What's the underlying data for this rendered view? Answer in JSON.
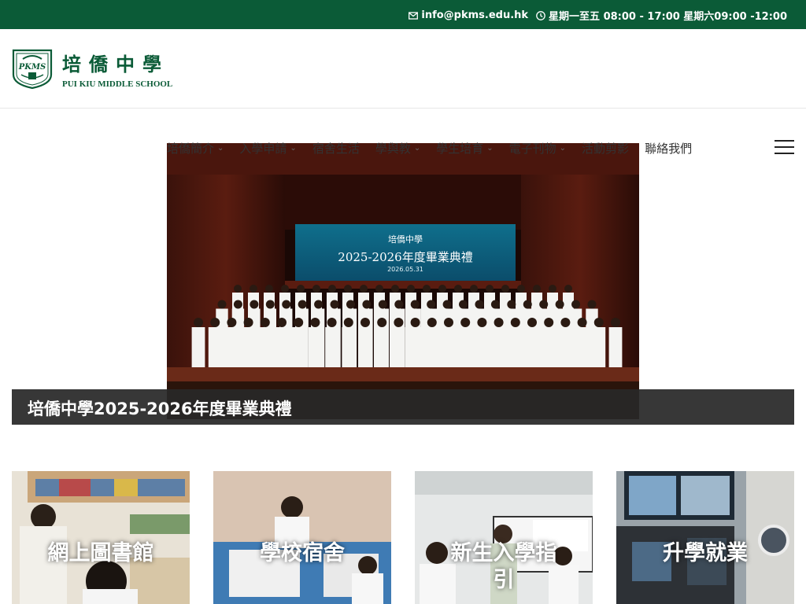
{
  "topbar": {
    "email": "info@pkms.edu.hk",
    "hours": "星期一至五 08:00 - 17:00 星期六09:00 -12:00"
  },
  "logo": {
    "name_cn": "培僑中學",
    "name_en": "PUI KIU MIDDLE SCHOOL",
    "badge_text": "PKMS"
  },
  "nav": {
    "items": [
      {
        "label": "培僑簡介",
        "has_dropdown": true
      },
      {
        "label": "入學申請",
        "has_dropdown": true
      },
      {
        "label": "宿舍生活",
        "has_dropdown": false
      },
      {
        "label": "學與教",
        "has_dropdown": true
      },
      {
        "label": "學生培育",
        "has_dropdown": true
      },
      {
        "label": "電子刊物",
        "has_dropdown": true
      },
      {
        "label": "活動剪影",
        "has_dropdown": false
      },
      {
        "label": "聯絡我們",
        "has_dropdown": false
      }
    ]
  },
  "hero": {
    "screen_line1": "培僑中學",
    "screen_line2": "2025-2026年度畢業典禮",
    "screen_date": "2026.05.31",
    "caption": "培僑中學2025-2026年度畢業典禮"
  },
  "cards": [
    {
      "label": "網上圖書館"
    },
    {
      "label": "學校宿舍"
    },
    {
      "label": "新生入學指引"
    },
    {
      "label": "升學就業"
    }
  ],
  "colors": {
    "brand_green": "#0b5b37",
    "caption_bg": "#282828"
  }
}
